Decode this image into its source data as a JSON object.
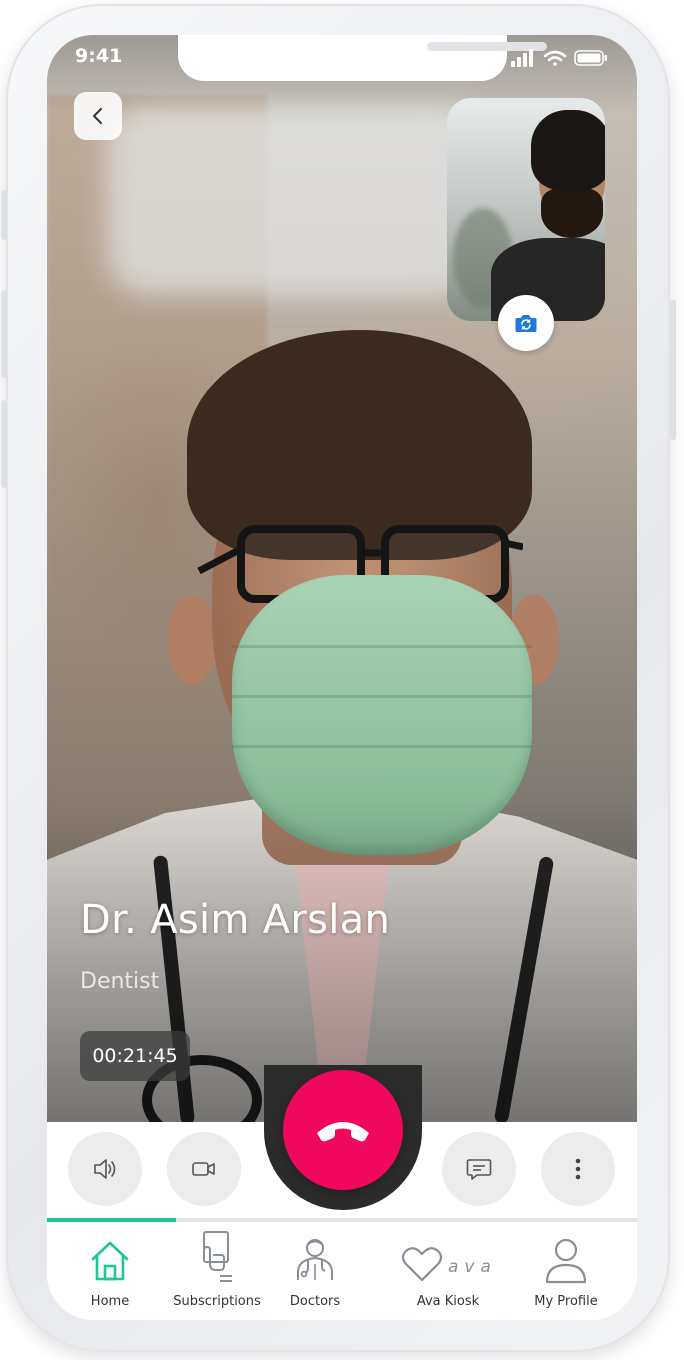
{
  "status_bar": {
    "time": "9:41"
  },
  "call": {
    "doctor_name": "Dr. Asim Arslan",
    "specialty": "Dentist",
    "duration": "00:21:45",
    "progress_fraction": 0.218
  },
  "controls": [
    {
      "name": "speaker-button",
      "icon": "speaker-icon"
    },
    {
      "name": "video-button",
      "icon": "video-camera-icon"
    },
    {
      "name": "end-call-button",
      "icon": "phone-hangup-icon"
    },
    {
      "name": "chat-button",
      "icon": "chat-icon"
    },
    {
      "name": "more-button",
      "icon": "more-vertical-icon"
    }
  ],
  "nav": {
    "active": "home",
    "items": [
      {
        "key": "home",
        "label": "Home",
        "icon": "home-icon"
      },
      {
        "key": "subscriptions",
        "label": "Subscriptions",
        "icon": "subscriptions-icon"
      },
      {
        "key": "doctors",
        "label": "Doctors",
        "icon": "doctor-icon"
      },
      {
        "key": "ava_kiosk",
        "label": "Ava Kiosk",
        "icon": "ava-heart-icon",
        "logo_text": "ava"
      },
      {
        "key": "my_profile",
        "label": "My Profile",
        "icon": "user-icon"
      }
    ]
  },
  "colors": {
    "accent": "#1cc699",
    "end_call": "#f0075e",
    "icon_gray": "#8a8f97",
    "control_bg": "#ececec"
  }
}
